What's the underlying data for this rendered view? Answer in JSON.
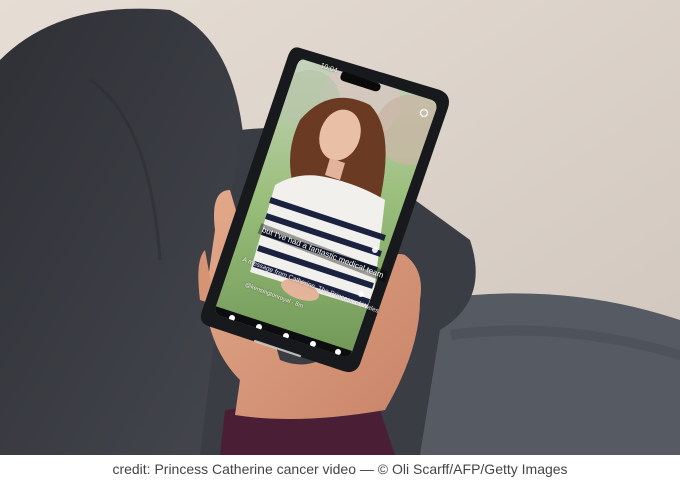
{
  "caption": "credit: Princess Catherine cancer video — © Oli Scarff/AFP/Getty Images",
  "phone": {
    "status_time": "10:04",
    "subtitle": "but I've had a fantastic medical team",
    "message": "A message from Catherine, The Princess of Wales",
    "handle": "@kensingtonroyal · 8m"
  },
  "colors": {
    "jeans": "#3a3c42",
    "sofa": "#5a5d66",
    "floor": "#d8cfc6",
    "sweater_stripe": "#1b2240",
    "sleeve": "#4a1f35",
    "skin": "#d89a7c"
  }
}
